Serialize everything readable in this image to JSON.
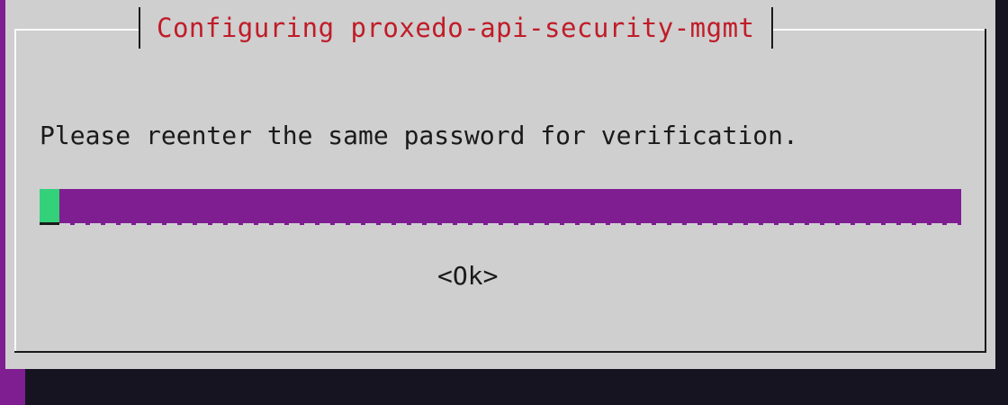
{
  "dialog": {
    "title": "Configuring proxedo-api-security-mgmt",
    "message": "Please reenter the same password for verification.",
    "password_input": {
      "value": ""
    },
    "ok_label": "<Ok>"
  },
  "colors": {
    "background": "#7e1e91",
    "dialog": "#cfcfcf",
    "title": "#c01c28",
    "input": "#7e1e91",
    "cursor": "#33d17a",
    "shadow": "#171421"
  }
}
